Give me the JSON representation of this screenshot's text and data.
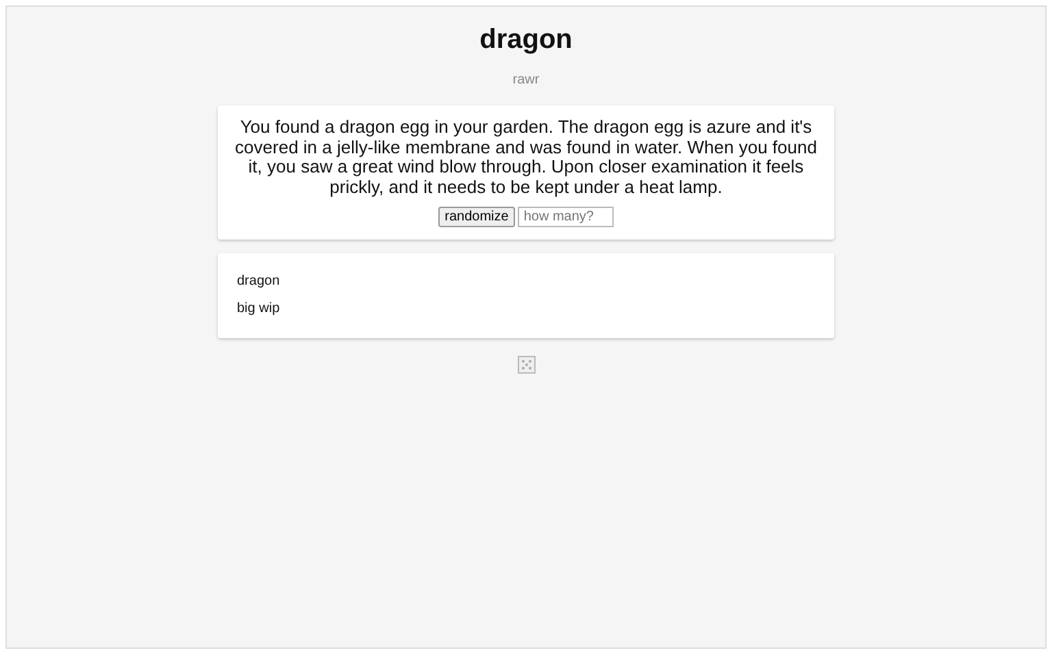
{
  "title": "dragon",
  "subtitle": "rawr",
  "description": "You found a dragon egg in your garden. The dragon egg is azure and it's covered in a jelly-like membrane and was found in water. When you found it, you saw a great wind blow through. Upon closer examination it feels prickly, and it needs to be kept under a heat lamp.",
  "randomize_button": "randomize",
  "count_field": {
    "placeholder": "how many?"
  },
  "notes": [
    "dragon",
    "big wip"
  ]
}
